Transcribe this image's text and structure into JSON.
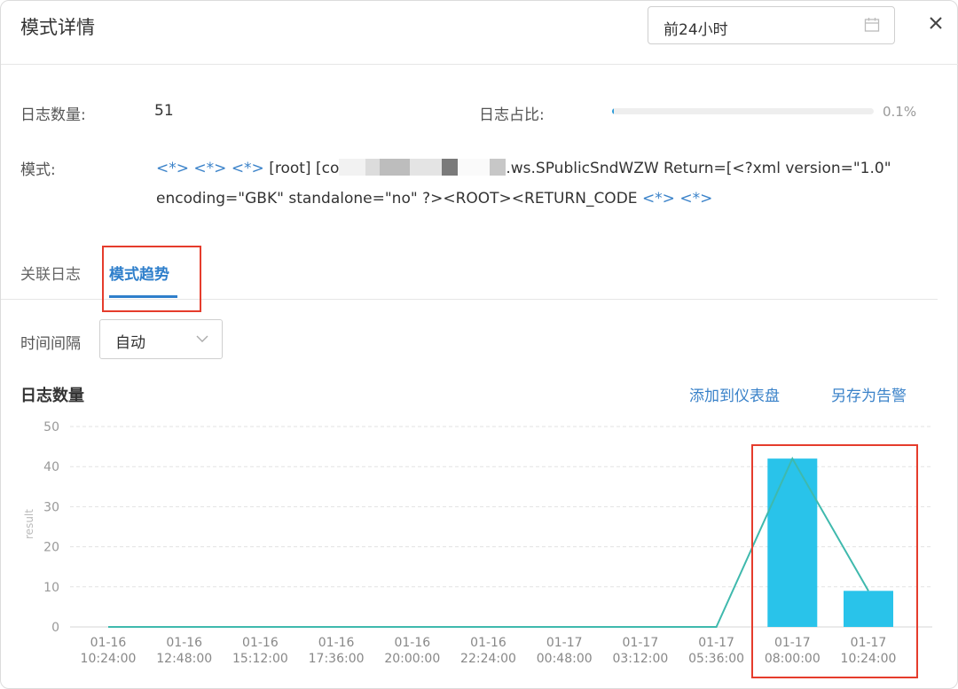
{
  "header": {
    "title": "模式详情",
    "date_range": "前24小时"
  },
  "summary": {
    "count_label": "日志数量:",
    "count_value": "51",
    "ratio_label": "日志占比:",
    "ratio_value": "0.1%",
    "ratio_fraction": 0.001
  },
  "pattern": {
    "label": "模式:",
    "wild1": "<*>",
    "wild2": "<*>",
    "wild3": "<*>",
    "part1": "[root] [co",
    "part2": ".ws.SPublicSndWZW Return=[<?xml version=\"1.0\" encoding=\"GBK\" standalone=\"no\" ?><ROOT><RETURN_CODE",
    "wild4": "<*>",
    "wild5": "<*>"
  },
  "tabs": {
    "related": "关联日志",
    "trend": "模式趋势"
  },
  "interval": {
    "label": "时间间隔",
    "value": "自动"
  },
  "chart_header": {
    "title": "日志数量",
    "add_dashboard": "添加到仪表盘",
    "save_alert": "另存为告警"
  },
  "colors": {
    "accent": "#2f7fcb",
    "bar": "#29c3ea",
    "line": "#3fb9ad",
    "highlight": "#e53c2c"
  },
  "chart_data": {
    "type": "bar",
    "categories": [
      "01-16 10:24:00",
      "01-16 12:48:00",
      "01-16 15:12:00",
      "01-16 17:36:00",
      "01-16 20:00:00",
      "01-16 22:24:00",
      "01-17 00:48:00",
      "01-17 03:12:00",
      "01-17 05:36:00",
      "01-17 08:00:00",
      "01-17 10:24:00"
    ],
    "values": [
      0,
      0,
      0,
      0,
      0,
      0,
      0,
      0,
      0,
      42,
      9
    ],
    "ylabel": "result",
    "ylim": [
      0,
      50
    ],
    "yticks": [
      0,
      10,
      20,
      30,
      40,
      50
    ],
    "grid": true,
    "overlay_line": true
  }
}
